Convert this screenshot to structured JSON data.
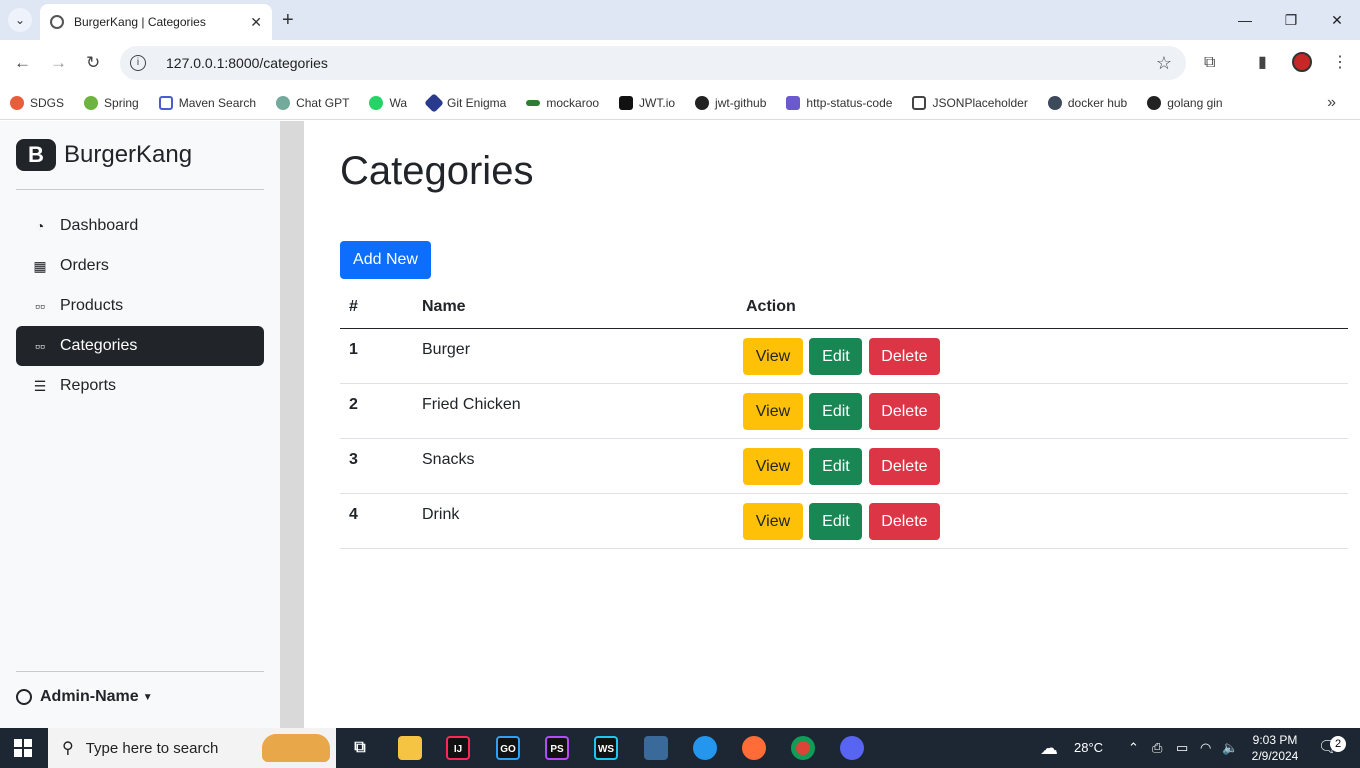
{
  "browser": {
    "tab_title": "BurgerKang | Categories",
    "url": "127.0.0.1:8000/categories",
    "bookmarks": [
      "SDGS",
      "Spring",
      "Maven Search",
      "Chat GPT",
      "Wa",
      "Git Enigma",
      "mockaroo",
      "JWT.io",
      "jwt-github",
      "http-status-code",
      "JSONPlaceholder",
      "docker hub",
      "golang gin"
    ]
  },
  "sidebar": {
    "brand_logo": "B",
    "brand": "BurgerKang",
    "items": [
      {
        "label": "Dashboard",
        "icon": "speedometer-icon"
      },
      {
        "label": "Orders",
        "icon": "table-icon"
      },
      {
        "label": "Products",
        "icon": "grid-icon"
      },
      {
        "label": "Categories",
        "icon": "grid-icon",
        "active": true
      },
      {
        "label": "Reports",
        "icon": "list-icon"
      }
    ],
    "user": "Admin-Name"
  },
  "main": {
    "title": "Categories",
    "add_button": "Add New",
    "columns": [
      "#",
      "Name",
      "Action"
    ],
    "rows": [
      {
        "id": "1",
        "name": "Burger"
      },
      {
        "id": "2",
        "name": "Fried Chicken"
      },
      {
        "id": "3",
        "name": "Snacks"
      },
      {
        "id": "4",
        "name": "Drink"
      }
    ],
    "actions": {
      "view": "View",
      "edit": "Edit",
      "delete": "Delete"
    }
  },
  "taskbar": {
    "search_placeholder": "Type here to search",
    "weather": "28°C",
    "time": "9:03 PM",
    "date": "2/9/2024",
    "notifications": "2"
  },
  "colors": {
    "primary": "#0d6efd",
    "warning": "#ffc107",
    "success": "#198754",
    "danger": "#dc3545",
    "dark": "#212529"
  }
}
